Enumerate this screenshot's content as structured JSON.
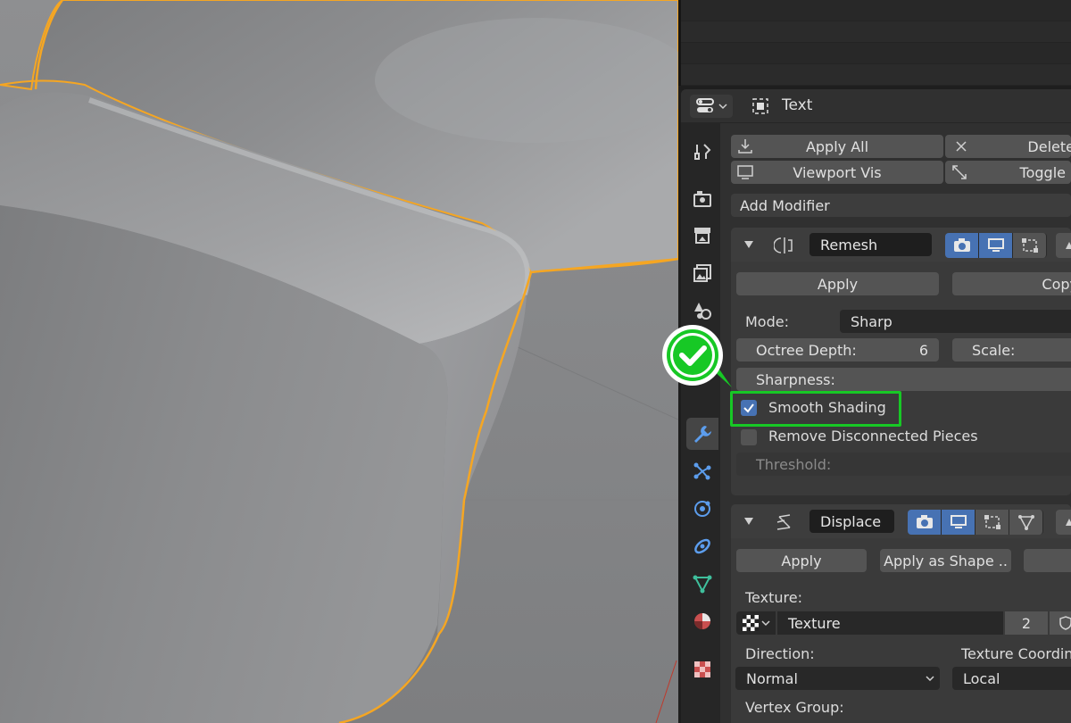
{
  "header": {
    "context_label": "Text"
  },
  "ops": {
    "apply_all": "Apply All",
    "delete": "Delete",
    "viewport_vis": "Viewport Vis",
    "toggle": "Toggle"
  },
  "add_modifier": "Add Modifier",
  "remesh": {
    "name": "Remesh",
    "apply": "Apply",
    "copy": "Copy",
    "mode_label": "Mode:",
    "mode_value": "Sharp",
    "octree_label": "Octree Depth:",
    "octree_value": "6",
    "scale_label": "Scale:",
    "sharpness_label": "Sharpness:",
    "smooth_shading_label": "Smooth Shading",
    "smooth_shading_checked": true,
    "remove_disconnected_label": "Remove Disconnected Pieces",
    "remove_disconnected_checked": false,
    "threshold_label": "Threshold:"
  },
  "displace": {
    "name": "Displace",
    "apply": "Apply",
    "apply_as_shape": "Apply as Shape ..",
    "texture_label": "Texture:",
    "texture_name": "Texture",
    "texture_users": "2",
    "direction_label": "Direction:",
    "direction_value": "Normal",
    "coords_label": "Texture Coordin",
    "coords_value": "Local",
    "vertex_group_label": "Vertex Group:"
  },
  "colors": {
    "accent": "#4772b3",
    "highlight": "#17c825",
    "selection_outline": "#f5a623"
  },
  "icons": {
    "tabs": [
      "tool-icon",
      "render-icon",
      "output-icon",
      "view-layer-icon",
      "scene-icon",
      "object-icon",
      "modifier-icon",
      "particles-icon",
      "physics-icon",
      "constraints-icon",
      "data-icon",
      "material-icon",
      "texture-icon"
    ]
  }
}
